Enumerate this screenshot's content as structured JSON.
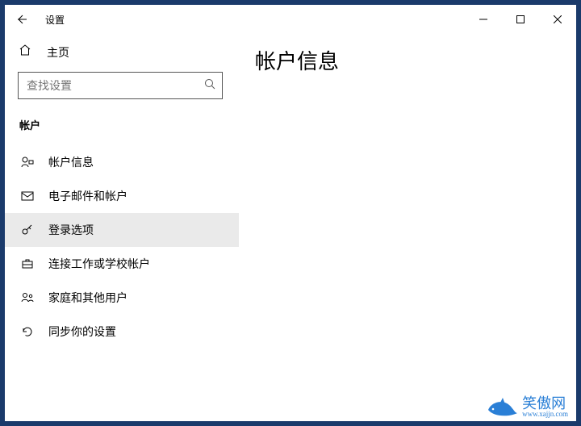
{
  "window": {
    "title": "设置"
  },
  "sidebar": {
    "home_label": "主页",
    "search_placeholder": "查找设置",
    "section_label": "帐户",
    "items": [
      {
        "label": "帐户信息"
      },
      {
        "label": "电子邮件和帐户"
      },
      {
        "label": "登录选项"
      },
      {
        "label": "连接工作或学校帐户"
      },
      {
        "label": "家庭和其他用户"
      },
      {
        "label": "同步你的设置"
      }
    ]
  },
  "main": {
    "heading": "帐户信息"
  },
  "watermark": {
    "text": "笑傲网",
    "url": "www.xajjn.com"
  }
}
